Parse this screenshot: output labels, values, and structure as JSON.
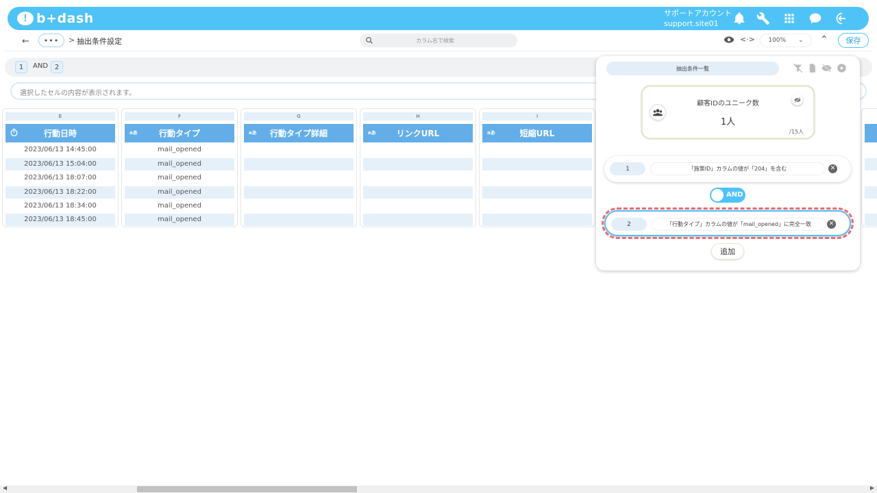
{
  "header": {
    "logo_text": "b+dash",
    "account_line1": "サポートアカウント",
    "account_line2": "support.site01"
  },
  "toolbar": {
    "back": "←",
    "more": "•••",
    "sep": ">",
    "breadcrumb": "抽出条件設定",
    "search_placeholder": "カラム名で検索",
    "code": "<·>",
    "zoom": "100%",
    "save": "保存"
  },
  "filters": {
    "chip1": "1",
    "op": "AND",
    "chip2": "2"
  },
  "cell_bar": {
    "placeholder": "選択したセルの内容が表示されます。"
  },
  "columns": [
    {
      "letter": "E",
      "title": "行動日時",
      "icon": "clock-icon",
      "type": "",
      "cells": [
        "2023/06/13 14:45:00",
        "2023/06/13 15:04:00",
        "2023/06/13 18:07:00",
        "2023/06/13 18:22:00",
        "2023/06/13 18:34:00",
        "2023/06/13 18:45:00"
      ]
    },
    {
      "letter": "F",
      "title": "行動タイプ",
      "type": "aあ",
      "cells": [
        "mail_opened",
        "mail_opened",
        "mail_opened",
        "mail_opened",
        "mail_opened",
        "mail_opened"
      ]
    },
    {
      "letter": "G",
      "title": "行動タイプ詳細",
      "type": "aあ",
      "cells": [
        "",
        "",
        "",
        "",
        "",
        ""
      ]
    },
    {
      "letter": "H",
      "title": "リンクURL",
      "type": "aあ",
      "cells": [
        "",
        "",
        "",
        "",
        "",
        ""
      ]
    },
    {
      "letter": "I",
      "title": "短縮URL",
      "type": "aあ",
      "cells": [
        "",
        "",
        "",
        "",
        "",
        ""
      ]
    }
  ],
  "panel": {
    "tab": "抽出条件一覧",
    "count_title": "顧客IDのユニーク数",
    "count_value": "1人",
    "count_total": "/15人",
    "conditions": [
      {
        "num": "1",
        "text": "「施策ID」カラムの値が「204」を含む"
      },
      {
        "num": "2",
        "text": "「行動タイプ」カラムの値が「mail_opened」に完全一致"
      }
    ],
    "and_label": "AND",
    "add": "追加",
    "x": "✕"
  },
  "colors": {
    "accent": "#4fc3f7",
    "header_blue": "#63aee9",
    "highlight": "#e86b74"
  }
}
